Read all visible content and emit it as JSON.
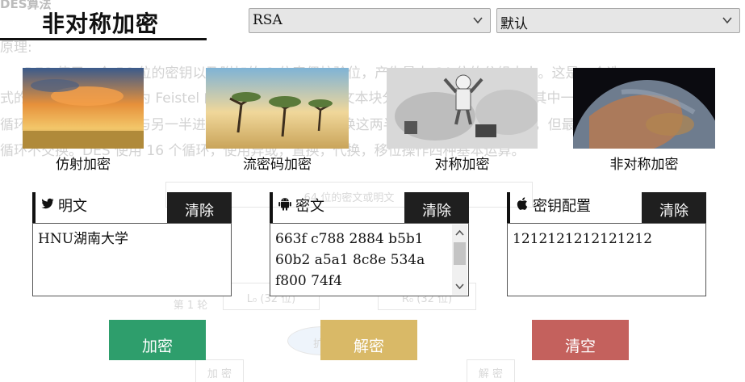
{
  "background": {
    "title": "DES算法",
    "lines": [
      "原理:",
      "DES 使用一个 56 位的密钥以及附加的 8 位奇偶校验位，产生最大 64 位的分组大小。这是一个迭",
      "式的分组密码，使用称为 Feistel 的技术，其中将加密的文本块分成两半。使用子密钥对其中一半应用",
      "循环功能，然后将输出与另一半进行\"异或\"运算；接着交换这两半，这一过程会继续下去，但最后一个",
      "循环不交换。DES 使用 16 个循环，使用异或，置换，代换，移位操作四种基本运算。"
    ],
    "diagram": [
      "64 位的密文或明文",
      "第 1 轮",
      "L₀ (32 位)",
      "R₀ (32 位)",
      "扩展",
      "加 密",
      "解 密"
    ]
  },
  "header": {
    "title": "非对称加密"
  },
  "selects": {
    "algorithm": {
      "value": "RSA"
    },
    "mode": {
      "value": "默认"
    }
  },
  "cards": [
    {
      "caption": "仿射加密"
    },
    {
      "caption": "流密码加密"
    },
    {
      "caption": "对称加密"
    },
    {
      "caption": "非对称加密"
    }
  ],
  "panels": {
    "plain": {
      "label": "明文",
      "clear": "清除",
      "icon": "twitter-icon",
      "value": "HNU湖南大学"
    },
    "cipher": {
      "label": "密文",
      "clear": "清除",
      "icon": "android-icon",
      "value": "663f c788 2884 b5b1 60b2 a5a1 8c8e 534a f800 74f4"
    },
    "key": {
      "label": "密钥配置",
      "clear": "清除",
      "icon": "apple-icon",
      "value": "1212121212121212"
    }
  },
  "actions": {
    "encrypt": "加密",
    "decrypt": "解密",
    "reset": "清空"
  },
  "colors": {
    "encrypt": "#2e9e6c",
    "decrypt": "#d9b967",
    "reset": "#c4615d",
    "clear": "#1f1f1f"
  }
}
